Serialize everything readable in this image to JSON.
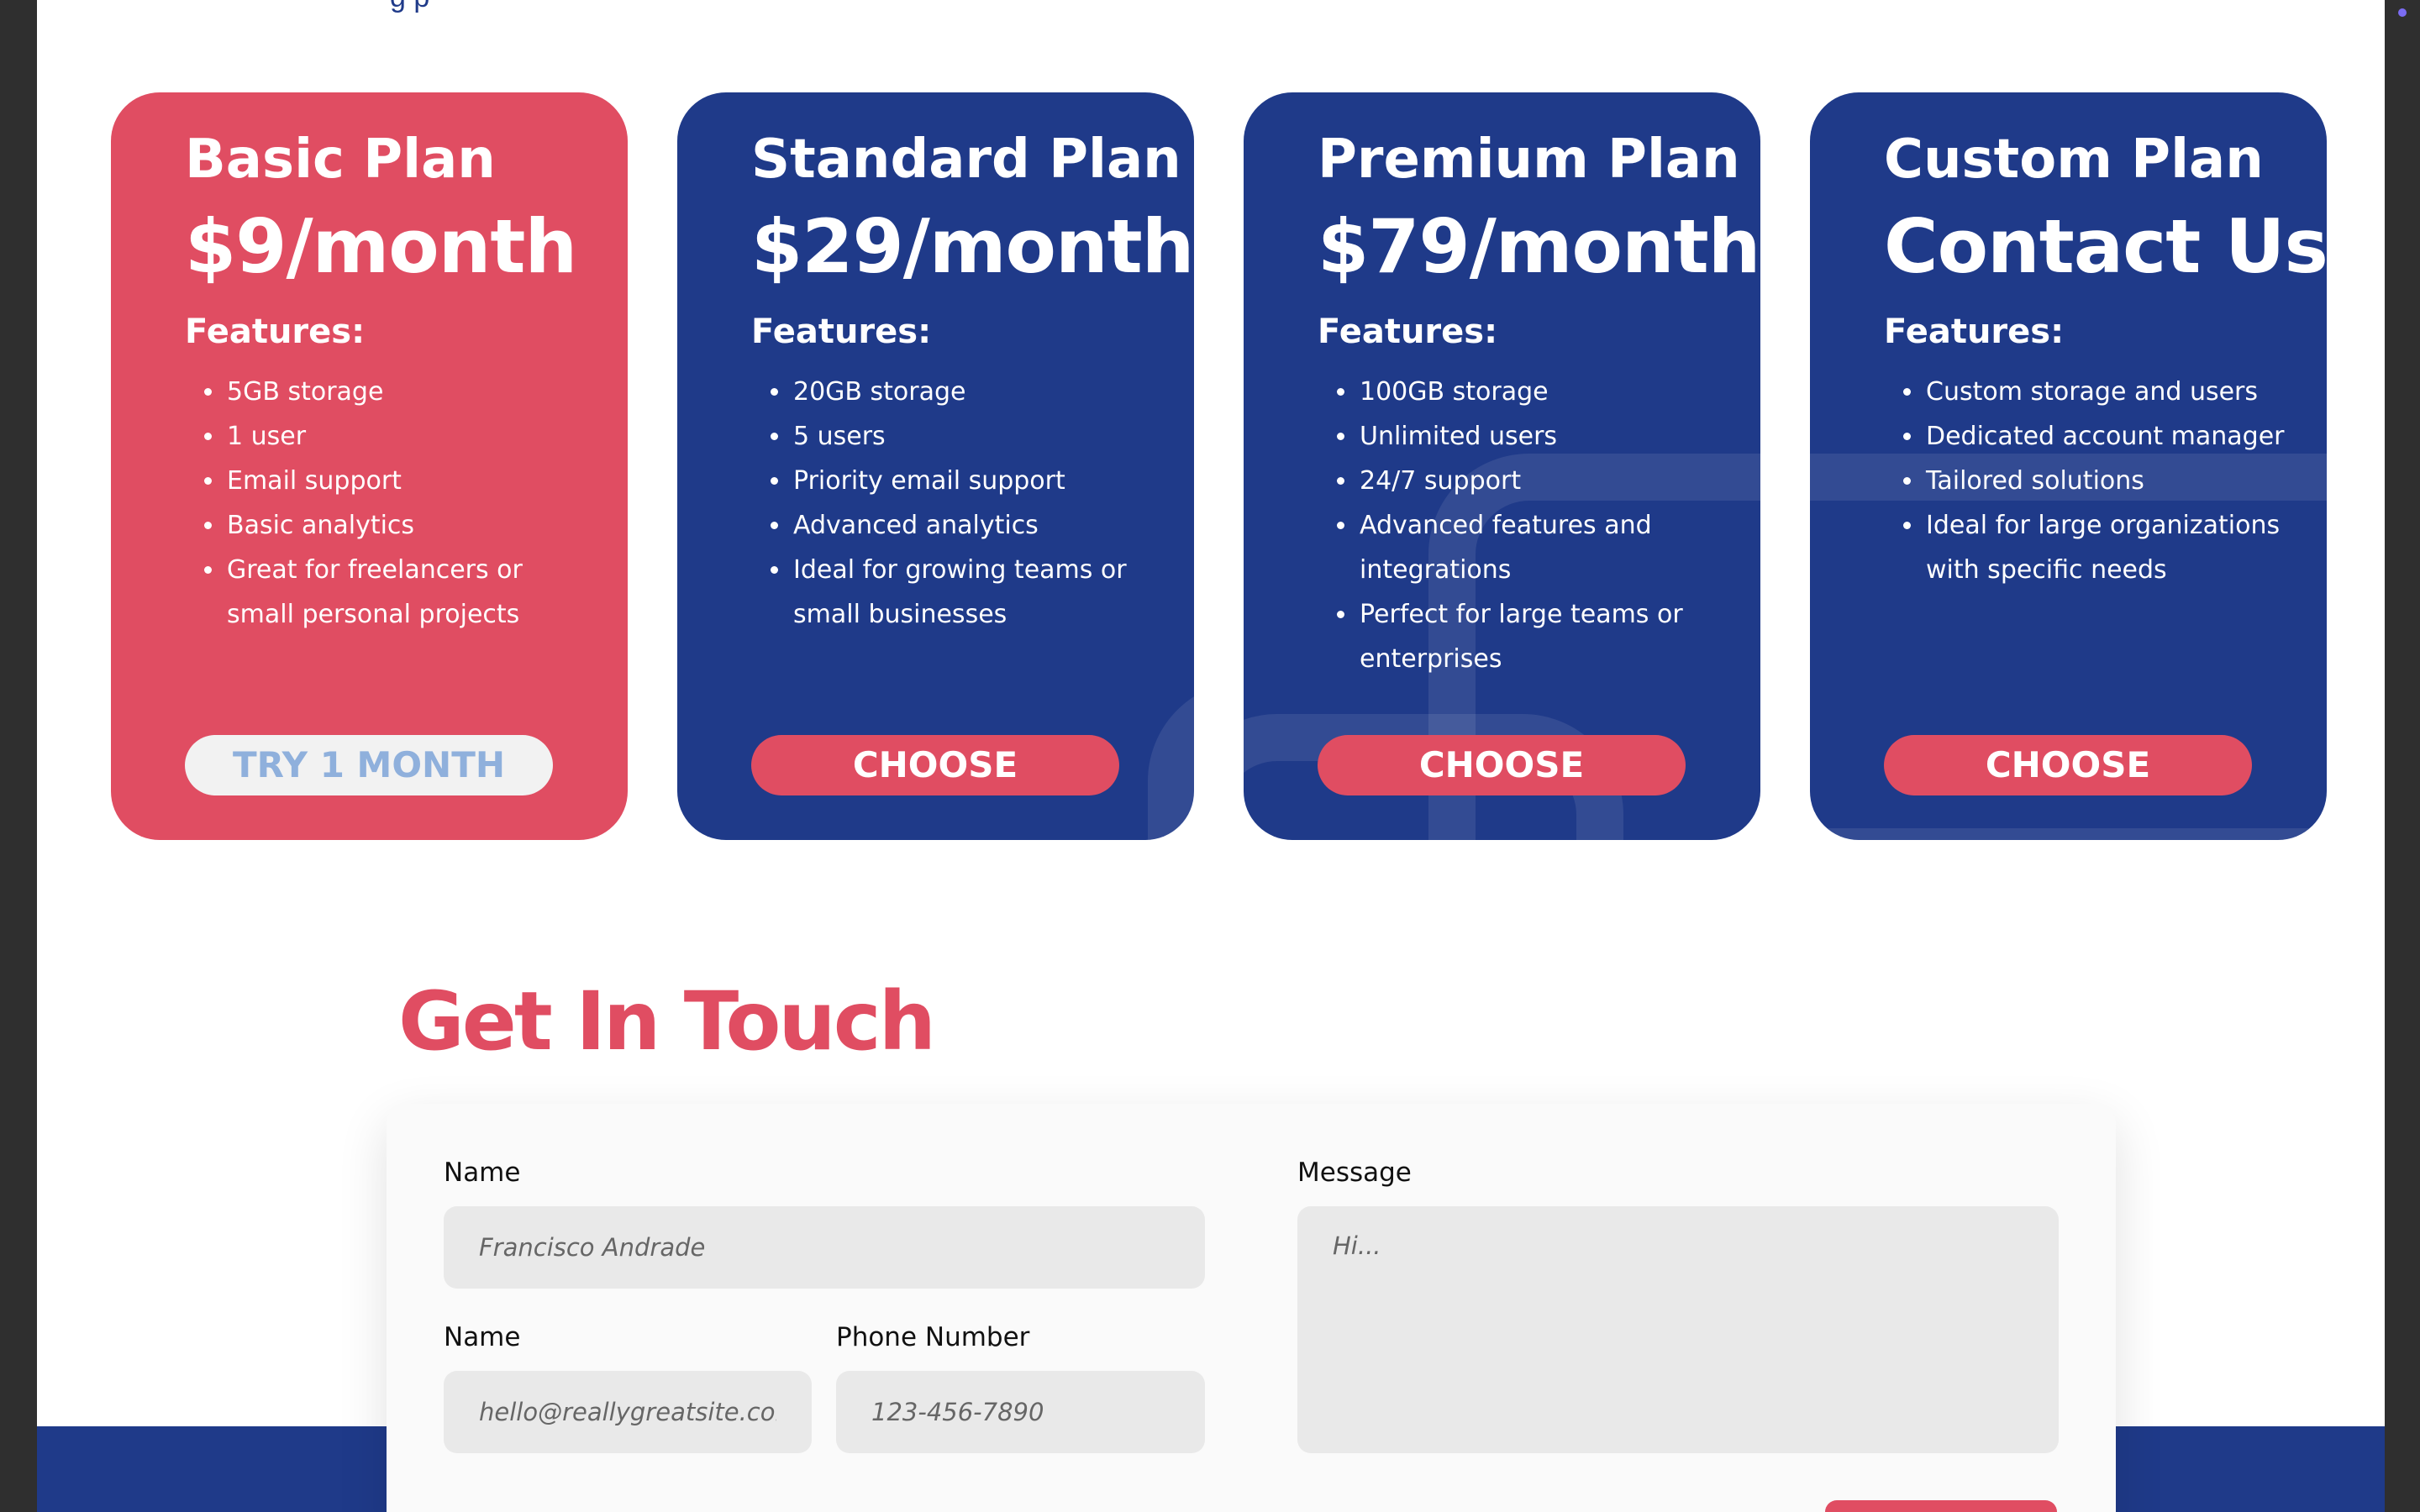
{
  "top_text": "g    p",
  "plans": [
    {
      "name": "Basic Plan",
      "price": "$9/month",
      "features_title": "Features:",
      "features": [
        "5GB storage",
        "1 user",
        "Email support",
        "Basic analytics",
        "Great for freelancers or small personal projects"
      ],
      "button": "TRY 1 MONTH"
    },
    {
      "name": "Standard Plan",
      "price": "$29/month",
      "features_title": "Features:",
      "features": [
        "20GB storage",
        "5 users",
        "Priority email support",
        "Advanced analytics",
        "Ideal for growing teams or small businesses"
      ],
      "button": "CHOOSE"
    },
    {
      "name": "Premium Plan",
      "price": "$79/month",
      "features_title": "Features:",
      "features": [
        "100GB storage",
        "Unlimited users",
        "24/7 support",
        "Advanced features and integrations",
        "Perfect for large teams or enterprises"
      ],
      "button": "CHOOSE"
    },
    {
      "name": "Custom Plan",
      "price": "Contact Us",
      "features_title": "Features:",
      "features": [
        "Custom storage and users",
        "Dedicated account manager",
        "Tailored solutions",
        "Ideal for large organizations with specific needs"
      ],
      "button": "CHOOSE"
    }
  ],
  "contact": {
    "title": "Get In Touch",
    "name_label": "Name",
    "name_placeholder": "Francisco Andrade",
    "email_label": "Name",
    "email_placeholder": "hello@reallygreatsite.com",
    "phone_label": "Phone Number",
    "phone_placeholder": "123-456-7890",
    "message_label": "Message",
    "message_placeholder": "Hi..."
  },
  "colors": {
    "accent_red": "#e04d62",
    "brand_blue": "#1f3a89",
    "button_light_text": "#8fb0dc"
  }
}
